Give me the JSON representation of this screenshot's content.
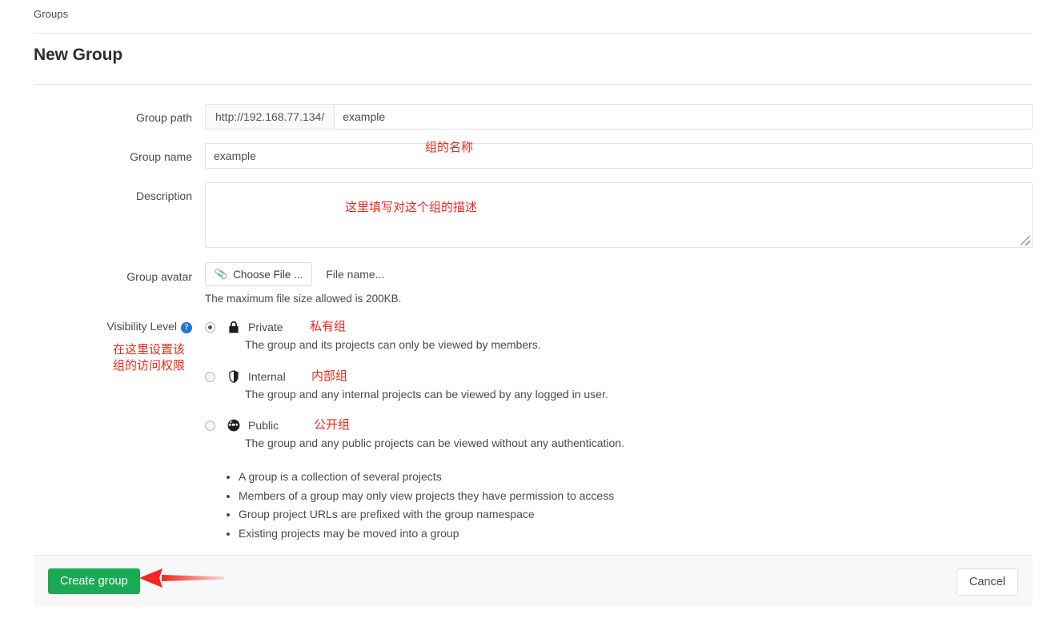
{
  "breadcrumb": {
    "label": "Groups"
  },
  "page": {
    "title": "New Group"
  },
  "form": {
    "group_path": {
      "label": "Group path",
      "prefix": "http://192.168.77.134/",
      "value": "example"
    },
    "group_name": {
      "label": "Group name",
      "value": "example"
    },
    "description": {
      "label": "Description",
      "value": ""
    },
    "group_avatar": {
      "label": "Group avatar",
      "choose_button": "Choose File ...",
      "file_name": "File name...",
      "hint": "The maximum file size allowed is 200KB."
    },
    "visibility": {
      "label": "Visibility Level",
      "help_glyph": "?",
      "options": [
        {
          "name": "Private",
          "icon": "lock-icon",
          "selected": true,
          "description": "The group and its projects can only be viewed by members."
        },
        {
          "name": "Internal",
          "icon": "shield-icon",
          "selected": false,
          "description": "The group and any internal projects can be viewed by any logged in user."
        },
        {
          "name": "Public",
          "icon": "globe-icon",
          "selected": false,
          "description": "The group and any public projects can be viewed without any authentication."
        }
      ]
    }
  },
  "notes": [
    "A group is a collection of several projects",
    "Members of a group may only view projects they have permission to access",
    "Group project URLs are prefixed with the group namespace",
    "Existing projects may be moved into a group"
  ],
  "footer": {
    "create_label": "Create group",
    "cancel_label": "Cancel"
  },
  "annotations": {
    "group_name_note": "组的名称",
    "description_note": "这里填写对这个组的描述",
    "visibility_note": "在这里设置该\n组的访问权限",
    "private_note": "私有组",
    "internal_note": "内部组",
    "public_note": "公开组"
  },
  "colors": {
    "primary_button": "#1aaa55",
    "annotation": "#f0281e",
    "help_badge": "#1f78d1"
  }
}
